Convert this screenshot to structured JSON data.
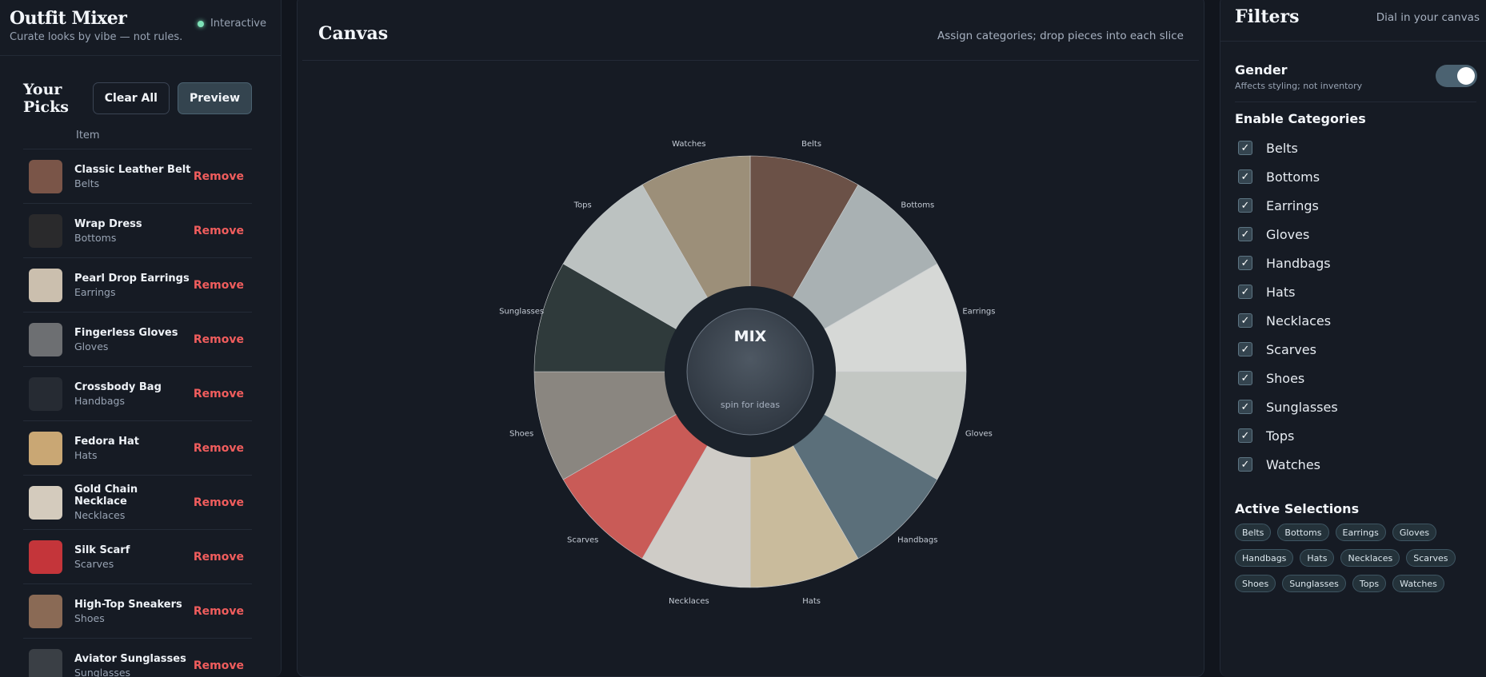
{
  "app": {
    "title": "Outfit Mixer",
    "subtitle": "Curate looks by vibe — not rules.",
    "status_label": "Interactive"
  },
  "picks": {
    "title": "Your Picks",
    "clear_label": "Clear All",
    "preview_label": "Preview",
    "column_item": "Item",
    "remove_label": "Remove",
    "items": [
      {
        "name": "Classic Leather Belt",
        "category": "Belts",
        "thumb_color": "#7a5548"
      },
      {
        "name": "Wrap Dress",
        "category": "Bottoms",
        "thumb_color": "#2a2a2c"
      },
      {
        "name": "Pearl Drop Earrings",
        "category": "Earrings",
        "thumb_color": "#cbbfae"
      },
      {
        "name": "Fingerless Gloves",
        "category": "Gloves",
        "thumb_color": "#6d6f72"
      },
      {
        "name": "Crossbody Bag",
        "category": "Handbags",
        "thumb_color": "#262b33"
      },
      {
        "name": "Fedora Hat",
        "category": "Hats",
        "thumb_color": "#c9a774"
      },
      {
        "name": "Gold Chain Necklace",
        "category": "Necklaces",
        "thumb_color": "#d4cbbd"
      },
      {
        "name": "Silk Scarf",
        "category": "Scarves",
        "thumb_color": "#c4353a"
      },
      {
        "name": "High-Top Sneakers",
        "category": "Shoes",
        "thumb_color": "#8a6a55"
      },
      {
        "name": "Aviator Sunglasses",
        "category": "Sunglasses",
        "thumb_color": "#3a3f45"
      }
    ]
  },
  "canvas": {
    "title": "Canvas",
    "hint": "Assign categories; drop pieces into each slice",
    "mix_label": "MIX",
    "mix_sub": "spin for ideas",
    "slices": [
      {
        "label": "Belts",
        "color": "#6b5147"
      },
      {
        "label": "Bottoms",
        "color": "#a9b1b3"
      },
      {
        "label": "Earrings",
        "color": "#d6d8d6"
      },
      {
        "label": "Gloves",
        "color": "#c3c7c3"
      },
      {
        "label": "Handbags",
        "color": "#5b6f7a"
      },
      {
        "label": "Hats",
        "color": "#c9bb9c"
      },
      {
        "label": "Necklaces",
        "color": "#cfccc7"
      },
      {
        "label": "Scarves",
        "color": "#c95b57"
      },
      {
        "label": "Shoes",
        "color": "#8a8680"
      },
      {
        "label": "Sunglasses",
        "color": "#2f3a3b"
      },
      {
        "label": "Tops",
        "color": "#bcc2c1"
      },
      {
        "label": "Watches",
        "color": "#9c8f79"
      }
    ]
  },
  "filters": {
    "title": "Filters",
    "hint": "Dial in your canvas",
    "gender_title": "Gender",
    "gender_sub": "Affects styling; not inventory",
    "gender_on": true,
    "categories_title": "Enable Categories",
    "check_glyph": "✓",
    "categories": [
      "Belts",
      "Bottoms",
      "Earrings",
      "Gloves",
      "Handbags",
      "Hats",
      "Necklaces",
      "Scarves",
      "Shoes",
      "Sunglasses",
      "Tops",
      "Watches"
    ],
    "active_title": "Active Selections",
    "active": [
      "Belts",
      "Bottoms",
      "Earrings",
      "Gloves",
      "Handbags",
      "Hats",
      "Necklaces",
      "Scarves",
      "Shoes",
      "Sunglasses",
      "Tops",
      "Watches"
    ]
  },
  "colors": {
    "accent": "#4b6271",
    "remove": "#f05d5d",
    "status": "#7ee2b8",
    "background": "#11151d",
    "panel": "#161b24"
  }
}
